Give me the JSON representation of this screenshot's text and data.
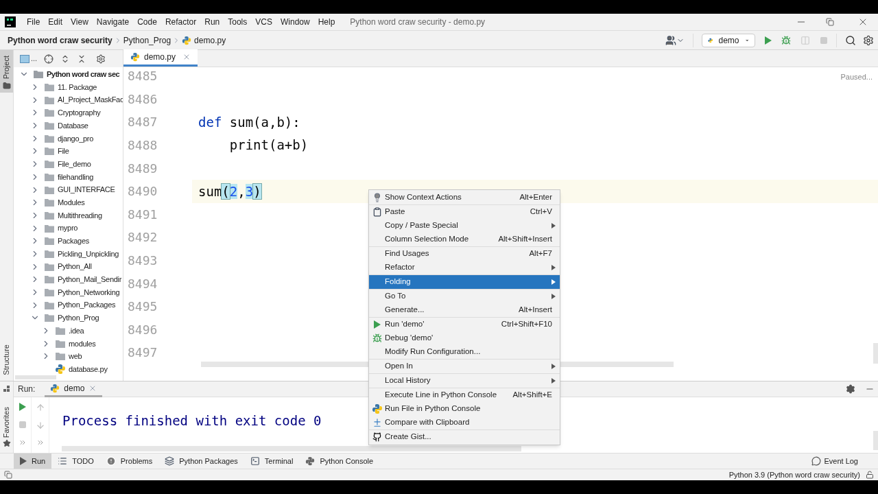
{
  "menu_bar": {
    "items": [
      "File",
      "Edit",
      "View",
      "Navigate",
      "Code",
      "Refactor",
      "Run",
      "Tools",
      "VCS",
      "Window",
      "Help"
    ],
    "title": "Python word craw security - demo.py"
  },
  "nav_bar": {
    "crumbs": [
      "Python word craw security",
      "Python_Prog",
      "demo.py"
    ],
    "run_config": "demo"
  },
  "side_strip": {
    "top": "Project",
    "bottom": "Structure",
    "favorites": "Favorites"
  },
  "project_tree": {
    "options": "...",
    "items": [
      {
        "label": "Python word craw sec",
        "kind": "root",
        "expanded": true,
        "children": [
          {
            "label": "11. Package",
            "kind": "folder",
            "expanded": false
          },
          {
            "label": "AI_Project_MaskFac",
            "kind": "folder",
            "expanded": false
          },
          {
            "label": "Cryptography",
            "kind": "folder",
            "expanded": false
          },
          {
            "label": "Database",
            "kind": "folder",
            "expanded": false
          },
          {
            "label": "django_pro",
            "kind": "folder",
            "expanded": false
          },
          {
            "label": "File",
            "kind": "folder",
            "expanded": false
          },
          {
            "label": "File_demo",
            "kind": "folder",
            "expanded": false
          },
          {
            "label": "filehandling",
            "kind": "folder",
            "expanded": false
          },
          {
            "label": "GUI_INTERFACE",
            "kind": "folder",
            "expanded": false
          },
          {
            "label": "Modules",
            "kind": "folder",
            "expanded": false
          },
          {
            "label": "Multithreading",
            "kind": "folder",
            "expanded": false
          },
          {
            "label": "mypro",
            "kind": "folder",
            "expanded": false
          },
          {
            "label": "Packages",
            "kind": "folder",
            "expanded": false
          },
          {
            "label": "Pickling_Unpickling",
            "kind": "folder",
            "expanded": false
          },
          {
            "label": "Python_All",
            "kind": "folder",
            "expanded": false
          },
          {
            "label": "Python_Mail_Sendir",
            "kind": "folder",
            "expanded": false
          },
          {
            "label": "Python_Networking",
            "kind": "folder",
            "expanded": false
          },
          {
            "label": "Python_Packages",
            "kind": "folder",
            "expanded": false
          },
          {
            "label": "Python_Prog",
            "kind": "folder",
            "expanded": true,
            "children": [
              {
                "label": ".idea",
                "kind": "folder",
                "expanded": false
              },
              {
                "label": "modules",
                "kind": "folder",
                "expanded": false
              },
              {
                "label": "web",
                "kind": "folder",
                "expanded": false
              },
              {
                "label": "database.py",
                "kind": "file"
              }
            ]
          }
        ]
      }
    ]
  },
  "editor": {
    "tab": "demo.py",
    "status": "Paused...",
    "lines": [
      {
        "number": "8485",
        "current": false
      },
      {
        "number": "8486",
        "current": false
      },
      {
        "number": "8487",
        "tokens": [
          {
            "text": "def ",
            "kind": "keyword"
          },
          {
            "text": "sum(a,b):",
            "kind": "plain"
          }
        ],
        "current": false
      },
      {
        "number": "8488",
        "tokens": [
          {
            "text": "    print(a+b)",
            "kind": "plain"
          }
        ],
        "current": false
      },
      {
        "number": "8489",
        "current": false
      },
      {
        "number": "8490",
        "tokens": [
          {
            "text": "sum",
            "kind": "plain"
          },
          {
            "text": "(",
            "kind": "brace"
          },
          {
            "text": "2",
            "kind": "number"
          },
          {
            "text": ",",
            "kind": "plain"
          },
          {
            "text": "3",
            "kind": "number"
          },
          {
            "text": ")",
            "kind": "brace"
          }
        ],
        "current": true
      },
      {
        "number": "8491",
        "current": false
      },
      {
        "number": "8492",
        "current": false
      },
      {
        "number": "8493",
        "current": false
      },
      {
        "number": "8494",
        "current": false
      },
      {
        "number": "8495",
        "current": false
      },
      {
        "number": "8496",
        "current": false
      },
      {
        "number": "8497",
        "current": false
      }
    ]
  },
  "context_menu": {
    "groups": [
      [
        {
          "label": "Show Context Actions",
          "shortcut": "Alt+Enter",
          "submenu": false,
          "selected": false
        }
      ],
      [
        {
          "label": "Paste",
          "shortcut": "Ctrl+V",
          "submenu": false,
          "selected": false
        },
        {
          "label": "Copy / Paste Special",
          "submenu": true,
          "selected": false
        },
        {
          "label": "Column Selection Mode",
          "shortcut": "Alt+Shift+Insert",
          "submenu": false,
          "selected": false
        }
      ],
      [
        {
          "label": "Find Usages",
          "shortcut": "Alt+F7",
          "submenu": false,
          "selected": false
        },
        {
          "label": "Refactor",
          "submenu": true,
          "selected": false
        }
      ],
      [
        {
          "label": "Folding",
          "submenu": true,
          "selected": true
        }
      ],
      [
        {
          "label": "Go To",
          "submenu": true,
          "selected": false
        },
        {
          "label": "Generate...",
          "shortcut": "Alt+Insert",
          "submenu": false,
          "selected": false
        }
      ],
      [
        {
          "label": "Run 'demo'",
          "shortcut": "Ctrl+Shift+F10",
          "submenu": false,
          "selected": false
        },
        {
          "label": "Debug 'demo'",
          "submenu": false,
          "selected": false
        },
        {
          "label": "Modify Run Configuration...",
          "submenu": false,
          "selected": false
        }
      ],
      [
        {
          "label": "Open In",
          "submenu": true,
          "selected": false
        }
      ],
      [
        {
          "label": "Local History",
          "submenu": true,
          "selected": false
        }
      ],
      [
        {
          "label": "Execute Line in Python Console",
          "shortcut": "Alt+Shift+E",
          "submenu": false,
          "selected": false
        },
        {
          "label": "Run File in Python Console",
          "submenu": false,
          "selected": false
        },
        {
          "label": "Compare with Clipboard",
          "submenu": false,
          "selected": false
        }
      ],
      [
        {
          "label": "Create Gist...",
          "submenu": false,
          "selected": false
        }
      ]
    ]
  },
  "run_panel": {
    "label": "Run:",
    "tab": "demo",
    "output": "Process finished with exit code 0"
  },
  "tool_windows": [
    {
      "label": "Run",
      "selected": true
    },
    {
      "label": "TODO",
      "selected": false
    },
    {
      "label": "Problems",
      "selected": false
    },
    {
      "label": "Python Packages",
      "selected": false
    },
    {
      "label": "Terminal",
      "selected": false
    },
    {
      "label": "Python Console",
      "selected": false
    }
  ],
  "event_log": "Event Log",
  "status_bar": {
    "interpreter": "Python 3.9 (Python word craw security)"
  }
}
